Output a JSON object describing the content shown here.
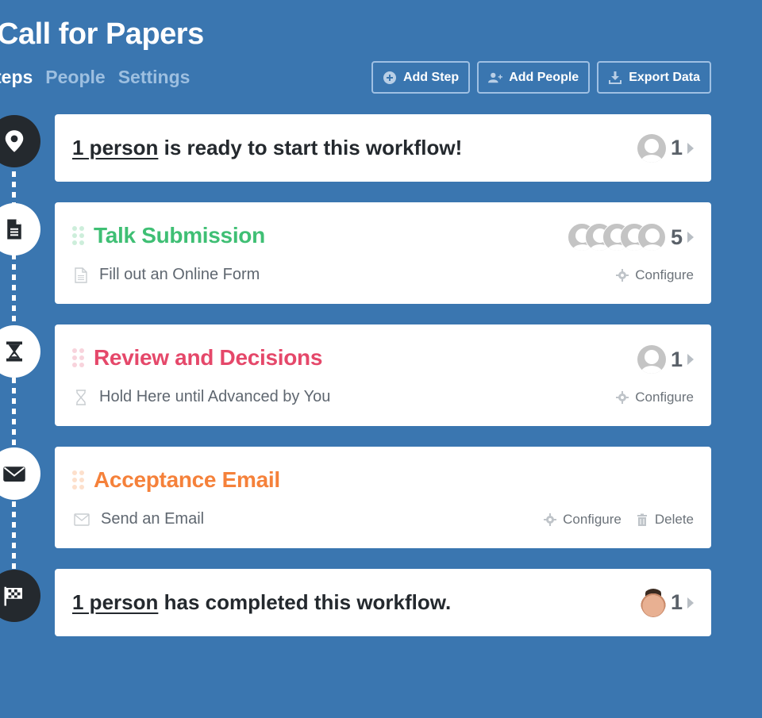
{
  "header": {
    "title": "Call for Papers",
    "tabs": [
      {
        "label": "Steps",
        "visible_label": "teps",
        "active": true
      },
      {
        "label": "People",
        "active": false
      },
      {
        "label": "Settings",
        "active": false
      }
    ],
    "buttons": {
      "add_step": "Add Step",
      "add_people": "Add People",
      "export_data": "Export Data"
    }
  },
  "workflow": {
    "start": {
      "link_text": "1 person",
      "text": " is ready to start this workflow!",
      "count": "1",
      "icon": "map-marker-icon"
    },
    "steps": [
      {
        "title": "Talk Submission",
        "color": "#3fbf74",
        "grip_color": "#cdeedb",
        "subtitle": "Fill out an Online Form",
        "sub_icon": "document-icon",
        "node_icon": "document-icon",
        "count": "5",
        "avatars": 5,
        "actions": [
          "Configure"
        ]
      },
      {
        "title": "Review and Decisions",
        "color": "#e5486a",
        "grip_color": "#f8d3dc",
        "subtitle": "Hold Here until Advanced by You",
        "sub_icon": "hourglass-icon",
        "node_icon": "hourglass-icon",
        "count": "1",
        "avatars": 1,
        "actions": [
          "Configure"
        ]
      },
      {
        "title": "Acceptance Email",
        "color": "#f5813a",
        "grip_color": "#fde0cc",
        "subtitle": "Send an Email",
        "sub_icon": "envelope-icon",
        "node_icon": "envelope-icon",
        "count": "",
        "avatars": 0,
        "actions": [
          "Configure",
          "Delete"
        ]
      }
    ],
    "end": {
      "link_text": "1 person",
      "text": " has completed this workflow.",
      "count": "1",
      "icon": "checkered-flag-icon"
    }
  },
  "colors": {
    "background": "#3a76b0",
    "dark_node": "#24292e"
  }
}
